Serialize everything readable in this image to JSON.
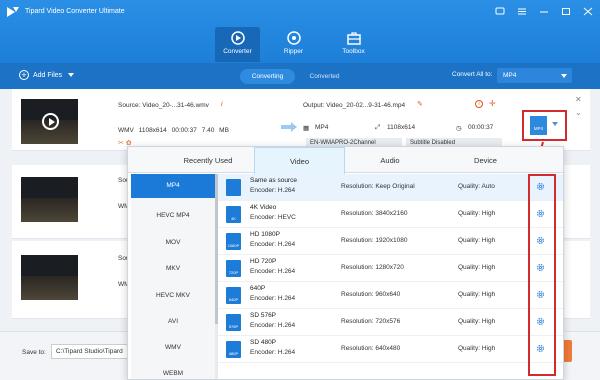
{
  "app": {
    "title": "Tipard Video Converter Ultimate"
  },
  "main_tabs": [
    {
      "label": "Converter",
      "icon": "converter-icon"
    },
    {
      "label": "Ripper",
      "icon": "ripper-icon"
    },
    {
      "label": "Toolbox",
      "icon": "toolbox-icon"
    }
  ],
  "toolbar": {
    "add_files": "Add Files",
    "converting": "Converting",
    "converted": "Converted",
    "convert_all_label": "Convert All to:",
    "convert_all_value": "MP4"
  },
  "file": {
    "source": "Source: Video_20-...31-46.wmv",
    "format": "WMV",
    "resolution": "1108x614",
    "duration": "00:00:37",
    "size": "7.40 MB",
    "output": "Output: Video_20-02...9-31-46.mp4",
    "out_format": "MP4",
    "out_resolution": "1108x614",
    "out_duration": "00:00:37",
    "audio_track": "EN-WMAPRO-2Channel",
    "subtitle": "Subtitle Disabled",
    "badge_label": "MP4"
  },
  "rows_partial": [
    {
      "src": "Sou",
      "fmt": "WM"
    },
    {
      "src": "Sou",
      "fmt": "WM"
    }
  ],
  "format_panel": {
    "tabs": [
      "Recently Used",
      "Video",
      "Audio",
      "Device"
    ],
    "active_tab": "Video",
    "categories": [
      "MP4",
      "HEVC MP4",
      "MOV",
      "MKV",
      "HEVC MKV",
      "AVI",
      "WMV",
      "WEBM"
    ],
    "active_category": "MP4",
    "presets": [
      {
        "name": "Same as source",
        "encoder": "Encoder: H.264",
        "resolution": "Resolution: Keep Original",
        "quality": "Quality: Auto",
        "icon_label": ""
      },
      {
        "name": "4K Video",
        "encoder": "Encoder: HEVC",
        "resolution": "Resolution: 3840x2160",
        "quality": "Quality: High",
        "icon_label": "4K"
      },
      {
        "name": "HD 1080P",
        "encoder": "Encoder: H.264",
        "resolution": "Resolution: 1920x1080",
        "quality": "Quality: High",
        "icon_label": "1080P"
      },
      {
        "name": "HD 720P",
        "encoder": "Encoder: H.264",
        "resolution": "Resolution: 1280x720",
        "quality": "Quality: High",
        "icon_label": "720P"
      },
      {
        "name": "640P",
        "encoder": "Encoder: H.264",
        "resolution": "Resolution: 960x640",
        "quality": "Quality: High",
        "icon_label": "640P"
      },
      {
        "name": "SD 576P",
        "encoder": "Encoder: H.264",
        "resolution": "Resolution: 720x576",
        "quality": "Quality: High",
        "icon_label": "576P"
      },
      {
        "name": "SD 480P",
        "encoder": "Encoder: H.264",
        "resolution": "Resolution: 640x480",
        "quality": "Quality: High",
        "icon_label": "480P"
      }
    ]
  },
  "bottom": {
    "save_to_label": "Save to:",
    "save_path": "C:\\Tipard Studio\\Tipard"
  },
  "colors": {
    "header_blue": "#1d7fd7",
    "accent_blue": "#1b79d8",
    "highlight_red": "#d32b2b",
    "convert_orange": "#f07a3b"
  }
}
